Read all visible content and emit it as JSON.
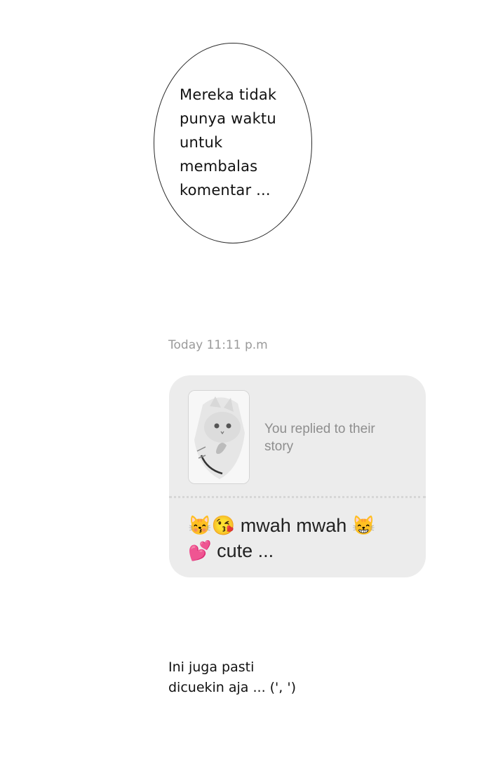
{
  "bubble": {
    "text": "Mereka tidak\npunya waktu\nuntuk\nmembalas\nkomentar ..."
  },
  "chat": {
    "timestamp": "Today 11:11 p.m",
    "story_reply_label": "You replied to their story",
    "message": "😽😘 mwah mwah 😸\n💕 cute ...",
    "thumbnail_icon": "cat-photo-icon"
  },
  "caption": {
    "text": "Ini juga pasti\ndicuekin aja ...  (', ')"
  }
}
